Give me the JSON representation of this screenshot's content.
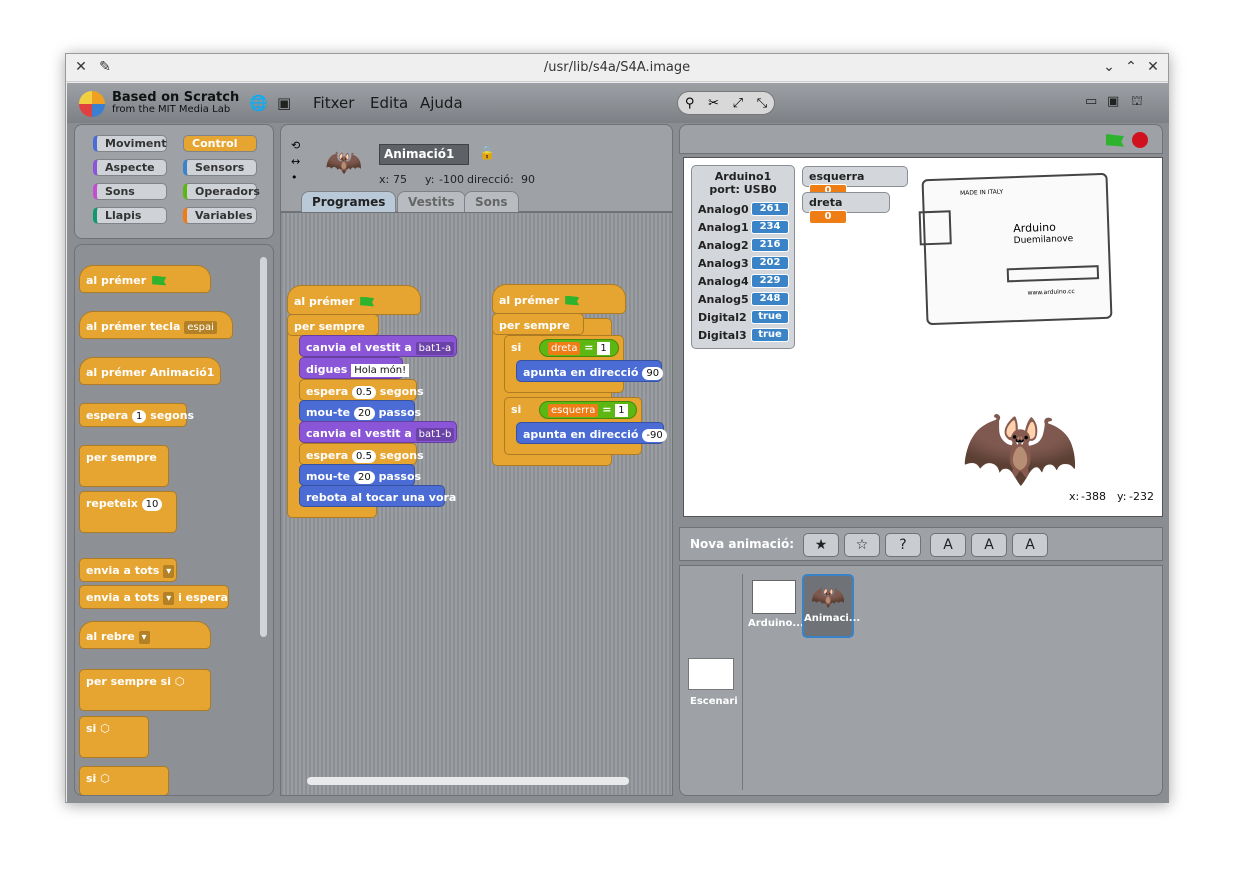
{
  "window": {
    "title": "/usr/lib/s4a/S4A.image"
  },
  "brand": {
    "line1": "Based on Scratch",
    "line2": "from the MIT Media Lab"
  },
  "menu": {
    "file": "Fitxer",
    "edit": "Edita",
    "help": "Ajuda"
  },
  "categories": [
    "Moviment",
    "Control",
    "Aspecte",
    "Sensors",
    "Sons",
    "Operadors",
    "Llapis",
    "Variables"
  ],
  "palette": {
    "when_flag": "al prémer",
    "when_key": "al prémer tecla",
    "key_val": "espai",
    "when_sprite": "al prémer  Animació1",
    "wait": "espera",
    "wait_val": "1",
    "wait_unit": "segons",
    "forever": "per sempre",
    "repeat": "repeteix",
    "repeat_val": "10",
    "broadcast": "envia a tots",
    "broadcast_wait": "envia a tots",
    "broadcast_wait_suffix": "i espera",
    "when_receive": "al rebre",
    "forever_if": "per sempre si",
    "if1": "si",
    "if2": "si"
  },
  "sprite": {
    "name": "Animació1",
    "x_label": "x:",
    "x": "75",
    "y_label": "y:",
    "y": "-100",
    "dir_label": "direcció:",
    "dir": "90"
  },
  "tabs": [
    "Programes",
    "Vestits",
    "Sons"
  ],
  "script1": {
    "hat": "al prémer",
    "forever": "per sempre",
    "switch1": "canvia el vestit a",
    "costume1": "bat1-a",
    "say": "digues",
    "say_val": "Hola món!",
    "wait1": "espera",
    "wait1_val": "0.5",
    "wait1_unit": "segons",
    "move1": "mou-te",
    "move1_val": "20",
    "move1_unit": "passos",
    "switch2": "canvia el vestit a",
    "costume2": "bat1-b",
    "wait2": "espera",
    "wait2_val": "0.5",
    "wait2_unit": "segons",
    "move2": "mou-te",
    "move2_val": "20",
    "move2_unit": "passos",
    "bounce": "rebota al tocar una vora"
  },
  "script2": {
    "hat": "al prémer",
    "forever": "per sempre",
    "if1": "si",
    "var1": "dreta",
    "eq1": "=",
    "val1": "1",
    "point1": "apunta en direcció",
    "dir1": "90",
    "if2": "si",
    "var2": "esquerra",
    "eq2": "=",
    "val2": "1",
    "point2": "apunta en direcció",
    "dir2": "-90"
  },
  "arduino": {
    "title": "Arduino1",
    "port": "port: USB0",
    "rows": [
      {
        "label": "Analog0",
        "value": "261"
      },
      {
        "label": "Analog1",
        "value": "234"
      },
      {
        "label": "Analog2",
        "value": "216"
      },
      {
        "label": "Analog3",
        "value": "202"
      },
      {
        "label": "Analog4",
        "value": "229"
      },
      {
        "label": "Analog5",
        "value": "248"
      },
      {
        "label": "Digital2",
        "value": "true"
      },
      {
        "label": "Digital3",
        "value": "true"
      }
    ]
  },
  "vars": {
    "esquerra": "esquerra",
    "esquerra_val": "0",
    "dreta": "dreta",
    "dreta_val": "0"
  },
  "board": {
    "brand": "Arduino",
    "model": "Duemilanove",
    "made": "MADE IN ITALY",
    "url": "www.arduino.cc"
  },
  "mouse": {
    "x_label": "x:",
    "x": "-388",
    "y_label": "y:",
    "y": "-232"
  },
  "new_sprite": "Nova animació:",
  "sprite_list": [
    {
      "name": "Arduino..."
    },
    {
      "name": "Animaci..."
    }
  ],
  "stage_label": "Escenari",
  "colors": {
    "control": "#e6a531",
    "looks": "#8a55d6",
    "motion": "#4a6cd4",
    "operators": "#5cb712",
    "variables": "#ee7d16",
    "sensor": "#3a83c7"
  }
}
